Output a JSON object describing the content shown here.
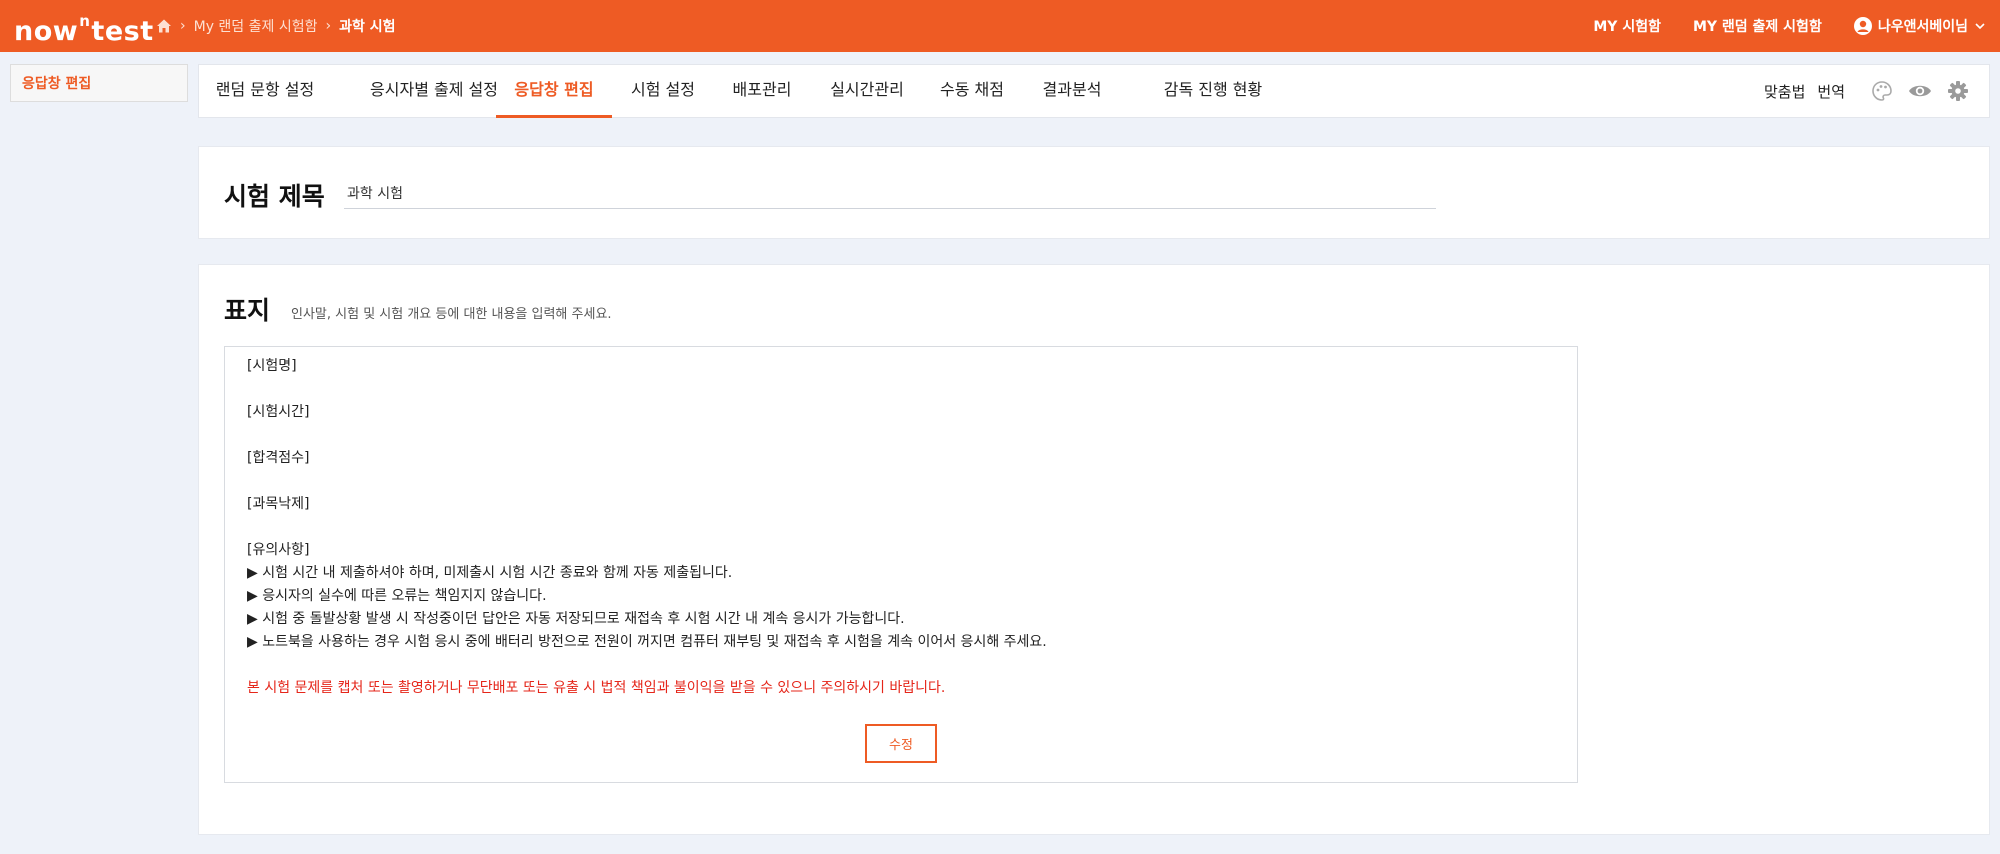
{
  "header": {
    "logo": {
      "pre": "now",
      "sup": "n",
      "post": "test"
    },
    "breadcrumb": [
      "My 랜덤 출제 시험함",
      "과학 시험"
    ],
    "nav": [
      "MY 시험함",
      "MY 랜덤 출제 시험함"
    ],
    "user": "나우앤서베이님",
    "brand_color": "#ee5b24"
  },
  "sidebar": {
    "item": "응답창 편집"
  },
  "tabs": [
    {
      "label": "랜덤 문항 설정",
      "active": false
    },
    {
      "label": "응시자별 출제 설정",
      "active": false
    },
    {
      "label": "응답창 편집",
      "active": true
    },
    {
      "label": "시험 설정",
      "active": false
    },
    {
      "label": "배포관리",
      "active": false
    },
    {
      "label": "실시간관리",
      "active": false
    },
    {
      "label": "수동 채점",
      "active": false
    },
    {
      "label": "결과분석",
      "active": false
    },
    {
      "label": "감독 진행 현황",
      "active": false
    }
  ],
  "tools": {
    "spellcheck": "맞춤법",
    "translate": "번역",
    "icons": [
      "palette-icon",
      "eye-icon",
      "gear-icon"
    ]
  },
  "title_section": {
    "label": "시험 제목",
    "value": "과학 시험"
  },
  "cover_section": {
    "label": "표지",
    "hint": "인사말, 시험 및 시험 개요 등에 대한 내용을 입력해 주세요.",
    "lines": [
      "[시험명]",
      "",
      "[시험시간]",
      "",
      "[합격점수]",
      "",
      "[과목낙제]",
      "",
      "[유의사항]",
      "▶ 시험 시간 내 제출하셔야 하며, 미제출시 시험 시간 종료와 함께 자동 제출됩니다.",
      "▶ 응시자의 실수에 따른 오류는 책임지지 않습니다.",
      "▶ 시험 중 돌발상황 발생 시 작성중이던 답안은 자동 저장되므로 재접속 후 시험 시간 내 계속 응시가 가능합니다.",
      "▶ 노트북을 사용하는 경우 시험 응시 중에 배터리 방전으로 전원이 꺼지면 컴퓨터 재부팅 및 재접속 후 시험을 계속 이어서 응시해 주세요.",
      ""
    ],
    "warning": "본 시험 문제를 캡처 또는 촬영하거나 무단배포 또는 유출 시 법적 책임과 불이익을 받을 수 있으니 주의하시기 바랍니다.",
    "edit_button": "수정"
  }
}
